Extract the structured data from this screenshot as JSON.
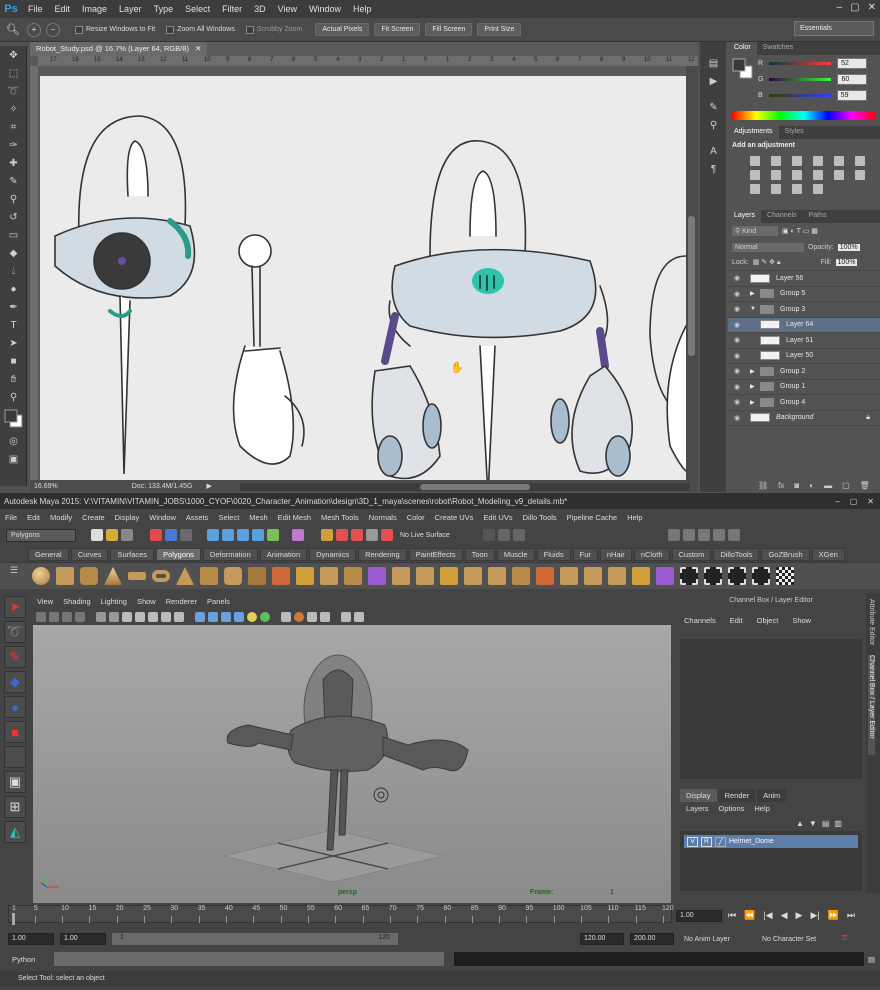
{
  "ps": {
    "logo": "Ps",
    "menus": [
      "File",
      "Edit",
      "Image",
      "Layer",
      "Type",
      "Select",
      "Filter",
      "3D",
      "View",
      "Window",
      "Help"
    ],
    "options": {
      "resize": "Resize Windows to Fit",
      "zoom_all": "Zoom All Windows",
      "scrubby": "Scrubby Zoom",
      "buttons": [
        "Actual Pixels",
        "Fit Screen",
        "Fill Screen",
        "Print Size"
      ],
      "workspace": "Essentials"
    },
    "doc_tab": "Robot_Study.psd @ 16.7% (Layer 64, RGB/8)",
    "ruler_nums": [
      "17",
      "16",
      "15",
      "14",
      "13",
      "12",
      "11",
      "10",
      "9",
      "8",
      "7",
      "6",
      "5",
      "4",
      "3",
      "2",
      "1",
      "0",
      "1",
      "2",
      "3",
      "4",
      "5",
      "6",
      "7",
      "8",
      "9",
      "10",
      "11",
      "12"
    ],
    "status": {
      "zoom": "16.69%",
      "doc": "Doc: 133.4M/1.45G"
    },
    "color": {
      "tabs": [
        "Color",
        "Swatches"
      ],
      "r": "52",
      "g": "60",
      "b": "59",
      "r_label": "R",
      "g_label": "G",
      "b_label": "B"
    },
    "adjustments": {
      "tabs": [
        "Adjustments",
        "Styles"
      ],
      "title": "Add an adjustment"
    },
    "layers": {
      "tabs": [
        "Layers",
        "Channels",
        "Paths"
      ],
      "kind": "Kind",
      "blend": "Normal",
      "opacity_label": "Opacity:",
      "opacity": "100%",
      "lock_label": "Lock:",
      "fill_label": "Fill:",
      "fill": "100%",
      "rows": [
        {
          "name": "Layer 56",
          "type": "thumb",
          "indent": 0
        },
        {
          "name": "Group 5",
          "type": "group",
          "indent": 0
        },
        {
          "name": "Group 3",
          "type": "group-open",
          "indent": 0
        },
        {
          "name": "Layer 64",
          "type": "thumb",
          "indent": 1,
          "selected": true
        },
        {
          "name": "Layer 51",
          "type": "thumb",
          "indent": 1
        },
        {
          "name": "Layer 50",
          "type": "thumb",
          "indent": 1
        },
        {
          "name": "Group 2",
          "type": "group",
          "indent": 0
        },
        {
          "name": "Group 1",
          "type": "group",
          "indent": 0
        },
        {
          "name": "Group 4",
          "type": "group",
          "indent": 0
        },
        {
          "name": "Background",
          "type": "thumb",
          "indent": 0,
          "italic": true
        }
      ]
    }
  },
  "maya": {
    "title": "Autodesk Maya 2015: V:\\VITAMIN\\VITAMIN_JOBS\\1000_CYOF\\0020_Character_Animation\\design\\3D_1_maya\\scenes\\robot\\Robot_Modeling_v9_details.mb*",
    "menus": [
      "File",
      "Edit",
      "Modify",
      "Create",
      "Display",
      "Window",
      "Assets",
      "Select",
      "Mesh",
      "Edit Mesh",
      "Mesh Tools",
      "Normals",
      "Color",
      "Create UVs",
      "Edit UVs",
      "Dillo Tools",
      "Pipeline Cache",
      "Help"
    ],
    "menuset": "Polygons",
    "live_surface": "No Live Surface",
    "shelf_tabs": [
      "General",
      "Curves",
      "Surfaces",
      "Polygons",
      "Deformation",
      "Animation",
      "Dynamics",
      "Rendering",
      "PaintEffects",
      "Toon",
      "Muscle",
      "Fluids",
      "Fur",
      "nHair",
      "nCloth",
      "Custom",
      "DilloTools",
      "GoZBrush",
      "XGen"
    ],
    "active_shelf": "Polygons",
    "viewport_menus": [
      "View",
      "Shading",
      "Lighting",
      "Show",
      "Renderer",
      "Panels"
    ],
    "hud": {
      "camera": "persp",
      "frame_label": "Frame:",
      "frame": "1"
    },
    "channel_box": {
      "title": "Channel Box / Layer Editor",
      "menus": [
        "Channels",
        "Edit",
        "Object",
        "Show"
      ],
      "tabs": [
        "Display",
        "Render",
        "Anim"
      ],
      "layer_menus": [
        "Layers",
        "Options",
        "Help"
      ],
      "layer": {
        "v": "V",
        "r": "R",
        "name": "Helmet_Dome"
      }
    },
    "side_tabs": [
      "Attribute Editor",
      "Channel Box / Layer Editor"
    ],
    "timeline_ticks": [
      "1",
      "5",
      "10",
      "15",
      "20",
      "25",
      "30",
      "35",
      "40",
      "45",
      "50",
      "55",
      "60",
      "65",
      "70",
      "75",
      "80",
      "85",
      "90",
      "95",
      "100",
      "105",
      "110",
      "115",
      "120"
    ],
    "current_frame": "1.00",
    "range": {
      "start": "1.00",
      "start2": "1.00",
      "slider_start": "1",
      "slider_end": "120",
      "end": "120.00",
      "end2": "200.00",
      "anim_layer": "No Anim Layer",
      "char_set": "No Character Set"
    },
    "cmd_label": "Python",
    "help": "Select Tool: select an object"
  },
  "colors": {
    "ps_accent": "#2fa3e6",
    "selection": "#5d6f87",
    "maya_layer": "#5d7ea8",
    "hud_green": "#1a6a1a"
  }
}
